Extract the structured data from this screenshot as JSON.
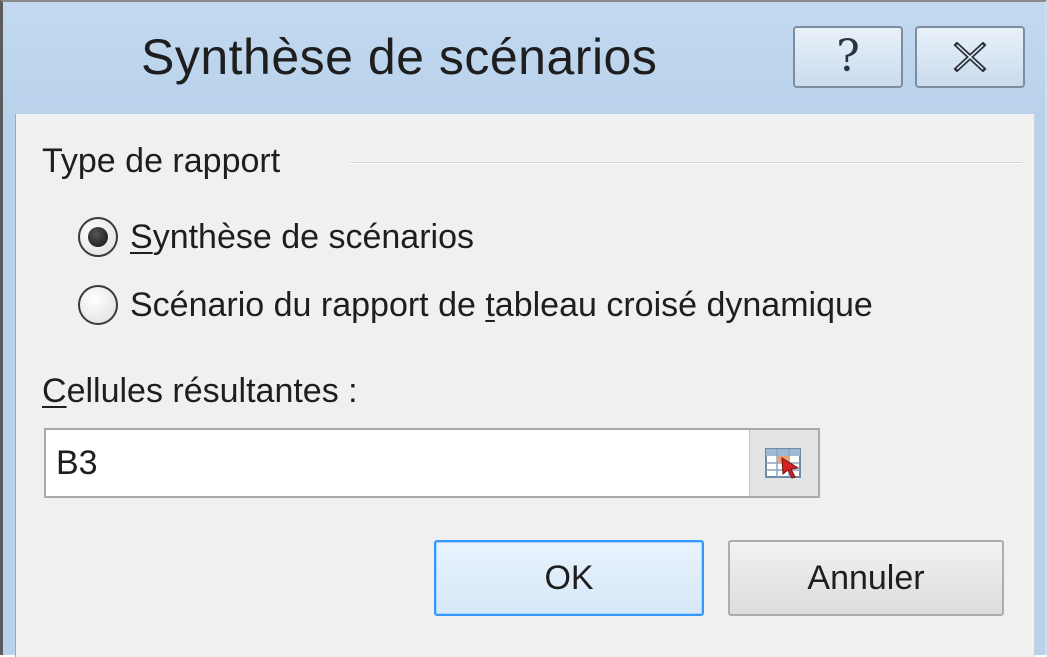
{
  "window": {
    "title": "Synthèse de scénarios",
    "help_label": "?",
    "close_label": "✕"
  },
  "report_group": {
    "label": "Type de rapport",
    "options": [
      {
        "prefix": "",
        "accel": "S",
        "rest": "ynthèse de scénarios",
        "selected": true
      },
      {
        "prefix": "Scénario du rapport de ",
        "accel": "t",
        "rest": "ableau croisé dynamique",
        "selected": false
      }
    ]
  },
  "result_cells": {
    "label_accel": "C",
    "label_rest": "ellules résultantes :",
    "value": "B3",
    "collapse_icon": "range-selector-icon"
  },
  "buttons": {
    "ok_label": "OK",
    "cancel_label": "Annuler"
  },
  "colors": {
    "title_bar": "#b9d1ea",
    "dialog_body": "#f0f0f0",
    "default_button_border": "#3399ff"
  }
}
